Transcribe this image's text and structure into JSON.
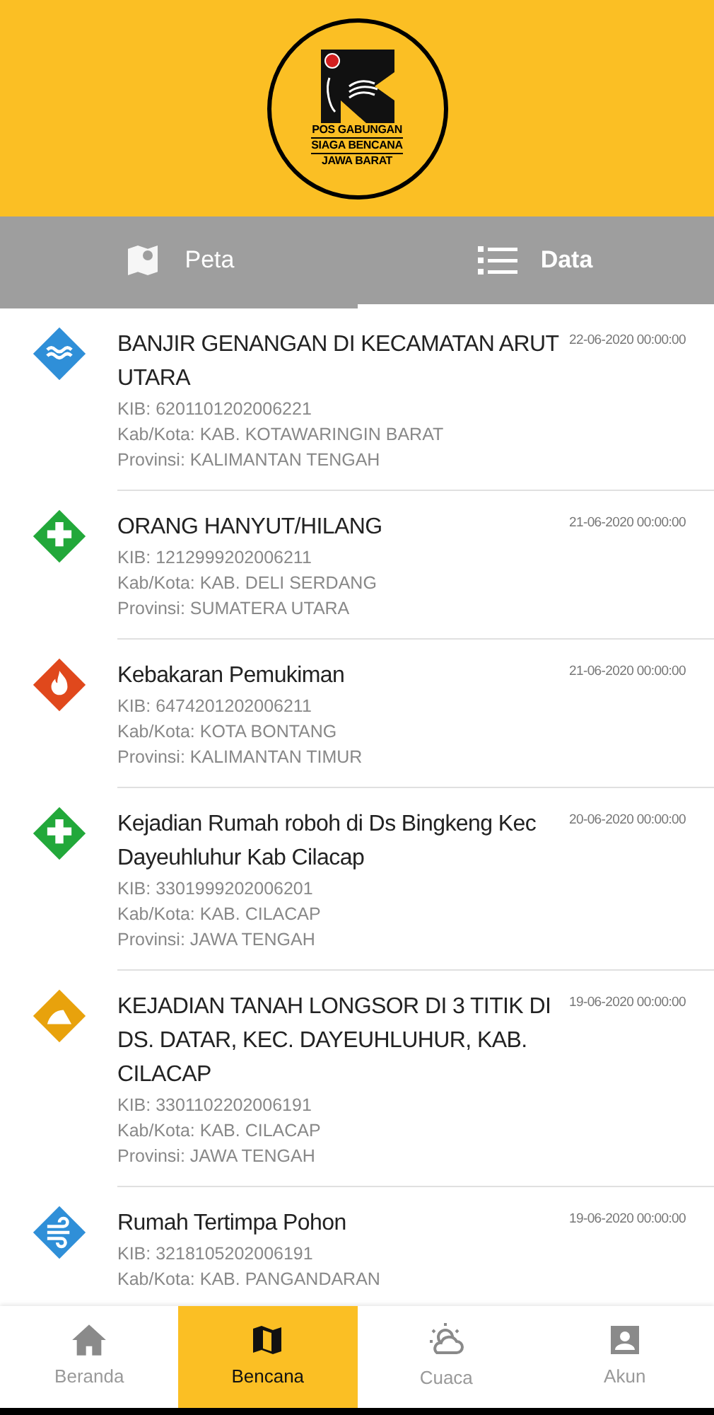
{
  "logo": {
    "lines": [
      "POS GABUNGAN",
      "SIAGA BENCANA",
      "JAWA BARAT"
    ]
  },
  "tabs": [
    {
      "label": "Peta",
      "kind": "map",
      "selected": false
    },
    {
      "label": "Data",
      "kind": "list",
      "selected": true
    }
  ],
  "items": [
    {
      "kind": "flood",
      "color": "#2f8fd8",
      "title": "BANJIR GENANGAN DI KECAMATAN ARUT UTARA",
      "date": "22-06-2020 00:00:00",
      "kib": "KIB: 6201101202006221",
      "kab": "Kab/Kota: KAB. KOTAWARINGIN BARAT",
      "prov": "Provinsi: KALIMANTAN TENGAH"
    },
    {
      "kind": "rescue",
      "color": "#22a83a",
      "title": "ORANG HANYUT/HILANG",
      "date": "21-06-2020 00:00:00",
      "kib": "KIB: 1212999202006211",
      "kab": "Kab/Kota: KAB. DELI SERDANG",
      "prov": "Provinsi: SUMATERA UTARA"
    },
    {
      "kind": "fire",
      "color": "#e0481c",
      "title": "Kebakaran Pemukiman",
      "date": "21-06-2020 00:00:00",
      "kib": "KIB: 6474201202006211",
      "kab": "Kab/Kota: KOTA BONTANG",
      "prov": "Provinsi: KALIMANTAN TIMUR"
    },
    {
      "kind": "rescue",
      "color": "#22a83a",
      "title": "Kejadian Rumah roboh di Ds Bingkeng Kec Dayeuhluhur Kab Cilacap",
      "date": "20-06-2020 00:00:00",
      "kib": "KIB: 3301999202006201",
      "kab": "Kab/Kota: KAB. CILACAP",
      "prov": "Provinsi: JAWA TENGAH"
    },
    {
      "kind": "landslide",
      "color": "#e8a20c",
      "title": "KEJADIAN TANAH LONGSOR DI 3 TITIK DI DS. DATAR, KEC. DAYEUHLUHUR, KAB. CILACAP",
      "date": "19-06-2020 00:00:00",
      "kib": "KIB: 3301102202006191",
      "kab": "Kab/Kota: KAB. CILACAP",
      "prov": "Provinsi: JAWA TENGAH"
    },
    {
      "kind": "wind",
      "color": "#2f8fd8",
      "title": "Rumah Tertimpa Pohon",
      "date": "19-06-2020 00:00:00",
      "kib": "KIB: 3218105202006191",
      "kab": "Kab/Kota: KAB. PANGANDARAN"
    }
  ],
  "nav": [
    {
      "label": "Beranda",
      "kind": "home",
      "selected": false
    },
    {
      "label": "Bencana",
      "kind": "map",
      "selected": true
    },
    {
      "label": "Cuaca",
      "kind": "weather",
      "selected": false
    },
    {
      "label": "Akun",
      "kind": "account",
      "selected": false
    }
  ]
}
